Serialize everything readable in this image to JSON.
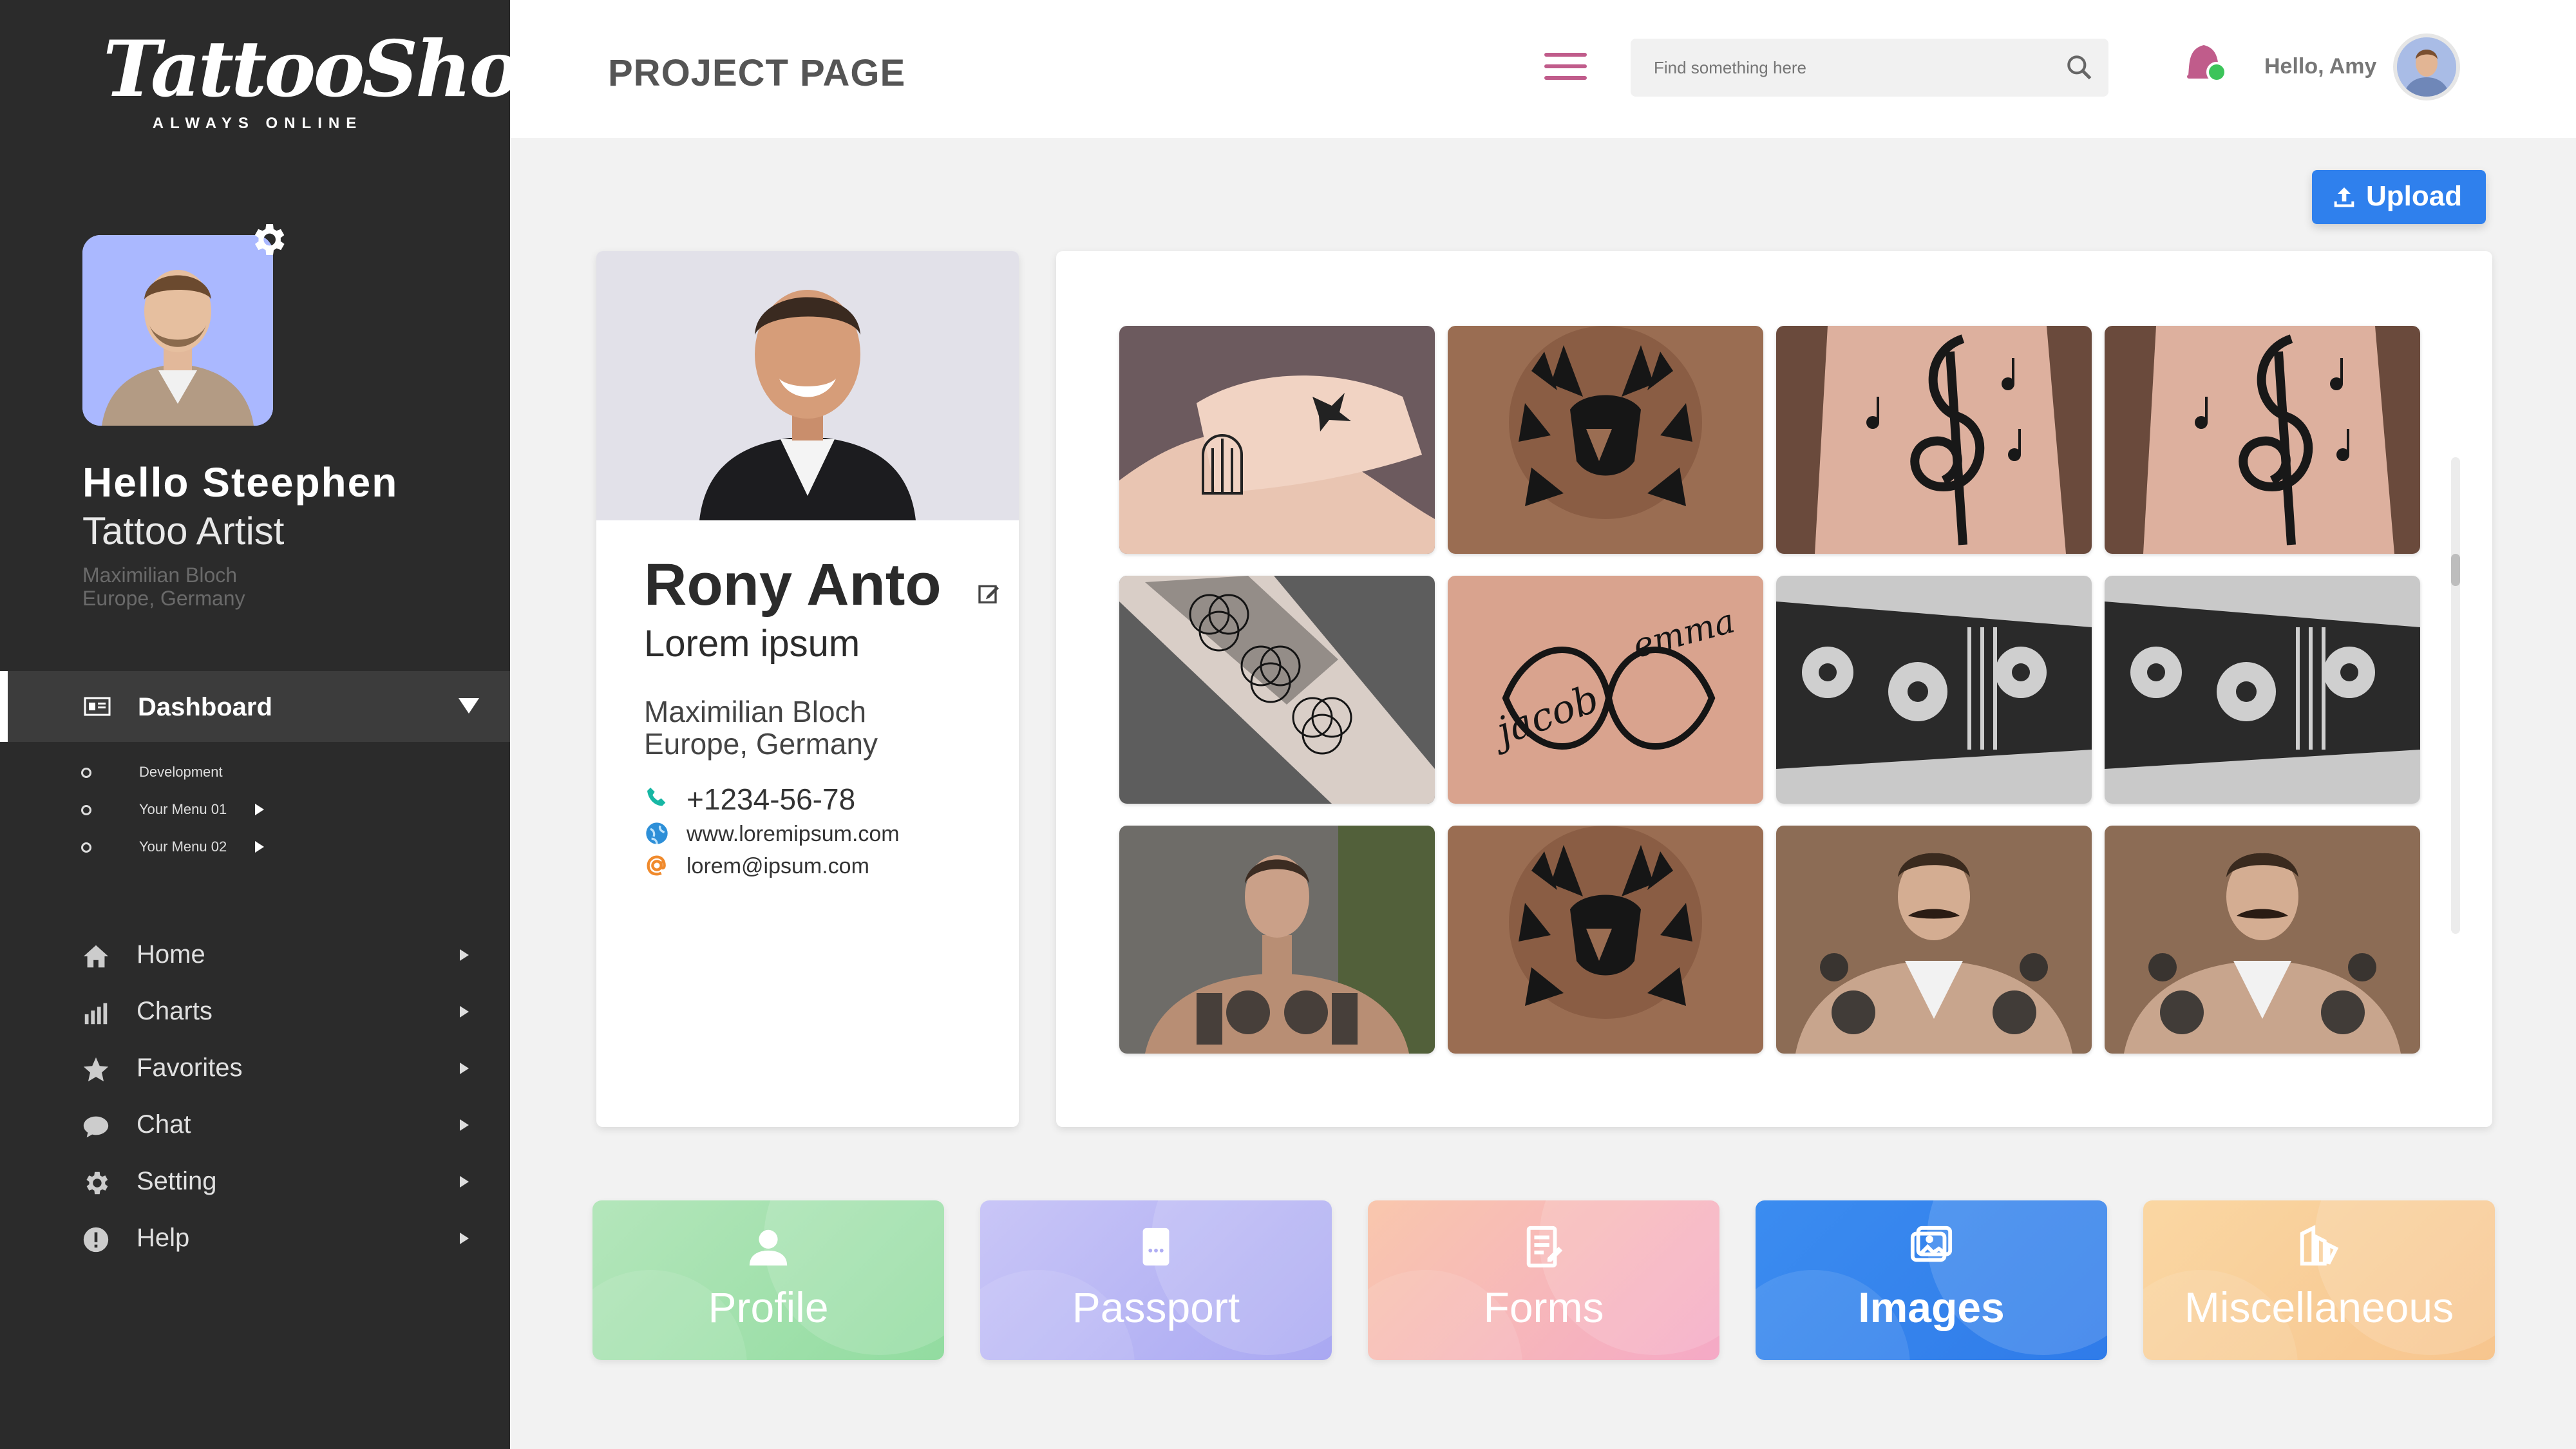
{
  "brand": {
    "name": "TattooShops",
    "tagline": "ALWAYS ONLINE"
  },
  "sidebar": {
    "greeting": "Hello  Steephen",
    "role": "Tattoo Artist",
    "location_line1": "Maximilian Bloch",
    "location_line2": "Europe, Germany",
    "active_item": {
      "label": "Dashboard",
      "icon": "dashboard-icon"
    },
    "sub_items": [
      {
        "label": "Development"
      },
      {
        "label": "Your Menu 01"
      },
      {
        "label": "Your Menu 02"
      }
    ],
    "menu": [
      {
        "label": "Home",
        "icon": "home-icon"
      },
      {
        "label": "Charts",
        "icon": "bar-chart-icon"
      },
      {
        "label": "Favorites",
        "icon": "star-icon"
      },
      {
        "label": "Chat",
        "icon": "chat-bubble-icon"
      },
      {
        "label": "Setting",
        "icon": "gear-icon"
      },
      {
        "label": "Help",
        "icon": "exclamation-icon"
      }
    ]
  },
  "header": {
    "title": "PROJECT PAGE",
    "search_placeholder": "Find something here",
    "user_greeting": "Hello, Amy",
    "accent_color": "#c05c8b"
  },
  "upload": {
    "label": "Upload",
    "color": "#2f80ed"
  },
  "profile": {
    "name": "Rony Anto",
    "subtitle": "Lorem ipsum",
    "address_line1": "Maximilian Bloch",
    "address_line2": "Europe, Germany",
    "phone": "+1234-56-78",
    "website": "www.loremipsum.com",
    "email": "lorem@ipsum.com"
  },
  "gallery": {
    "images": [
      "hand-bird-cage-tattoo",
      "lion-tattoo",
      "treble-clef-neck-tattoo",
      "treble-clef-neck-tattoo",
      "geometric-arm-tattoo",
      "infinity-names-tattoo",
      "floral-sleeve-tattoo",
      "floral-sleeve-tattoo",
      "tattooed-man-portrait",
      "lion-tattoo",
      "tattooed-man-mustache",
      "tattooed-man-mustache"
    ]
  },
  "tiles": [
    {
      "label": "Profile",
      "icon": "person-icon",
      "color": "#9be0a5"
    },
    {
      "label": "Passport",
      "icon": "passport-icon",
      "color": "#b3b2f4"
    },
    {
      "label": "Forms",
      "icon": "form-icon",
      "color": "#f6b6c4"
    },
    {
      "label": "Images",
      "icon": "images-icon",
      "color": "#2f80ed"
    },
    {
      "label": "Miscellaneous",
      "icon": "misc-icon",
      "color": "#f8cf98"
    }
  ]
}
